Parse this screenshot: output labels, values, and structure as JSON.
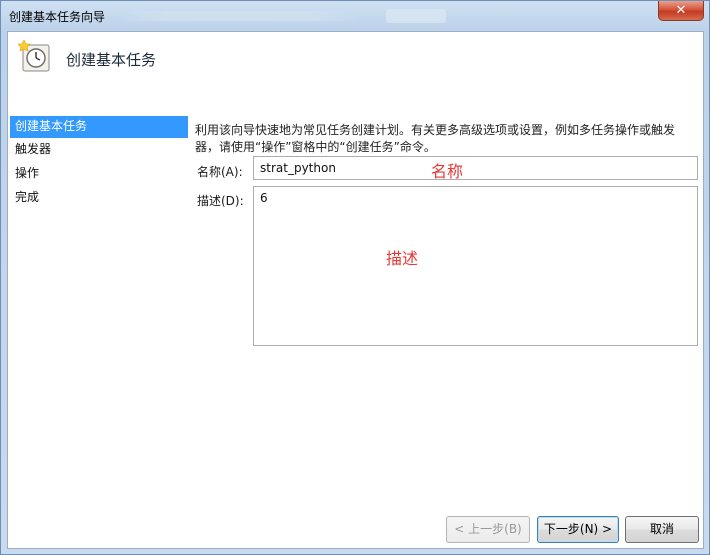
{
  "window": {
    "title": "创建基本任务向导",
    "close_glyph": "✕"
  },
  "header": {
    "title": "创建基本任务",
    "icon": "scheduled-task-clock-icon"
  },
  "nav": {
    "items": [
      {
        "label": "创建基本任务",
        "active": true
      },
      {
        "label": "触发器",
        "active": false
      },
      {
        "label": "操作",
        "active": false
      },
      {
        "label": "完成",
        "active": false
      }
    ]
  },
  "main": {
    "intro": "利用该向导快速地为常见任务创建计划。有关更多高级选项或设置，例如多任务操作或触发器，请使用“操作”窗格中的“创建任务”命令。",
    "name_label": "名称(A):",
    "name_value": "strat_python",
    "desc_label": "描述(D):",
    "desc_value": "6",
    "annotation_name": "名称",
    "annotation_desc": "描述",
    "annotation_color": "#e53935"
  },
  "buttons": {
    "back": "< 上一步(B)",
    "next": "下一步(N) >",
    "cancel": "取消"
  },
  "colors": {
    "nav_active_bg": "#3399ff",
    "close_button": "#c23c22"
  }
}
